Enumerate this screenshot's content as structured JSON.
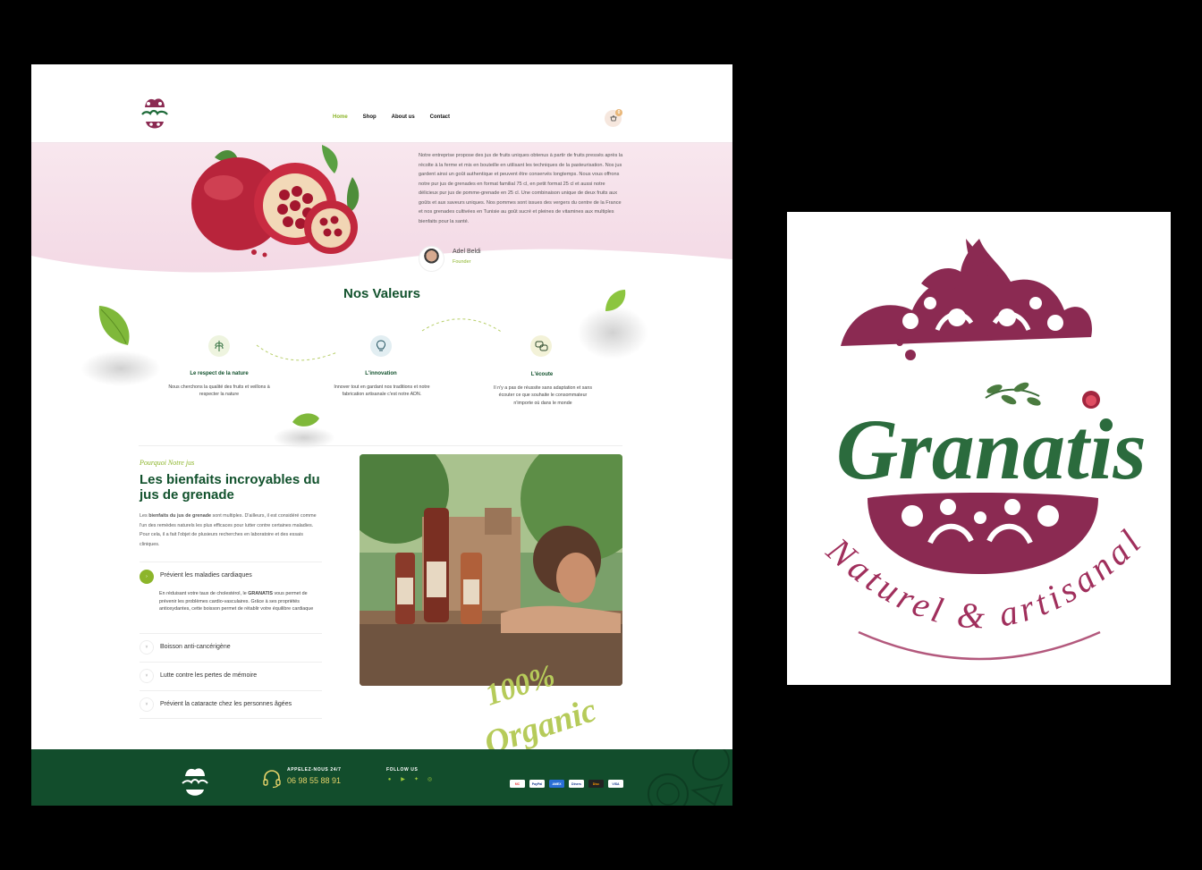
{
  "brand": {
    "name": "Granatis",
    "tagline": "Naturel & artisanal"
  },
  "colors": {
    "primary": "#12522d",
    "accent": "#8cb52a",
    "wine": "#8b2a52",
    "footer": "#124d2c",
    "hero_pink": "#f6dfe9"
  },
  "nav": {
    "items": [
      {
        "label": "Home",
        "active": true
      },
      {
        "label": "Shop",
        "active": false
      },
      {
        "label": "About us",
        "active": false
      },
      {
        "label": "Contact",
        "active": false
      }
    ],
    "cart_count": "0"
  },
  "hero": {
    "text": "Notre entreprise propose des jus de fruits uniques obtenus à partir de fruits pressés après la récolte à la ferme et mis en bouteille en utilisant les techniques de la pasteurisation. Nos jus gardent ainsi un goût authentique et peuvent être conservés longtemps. Nous vous offrons notre pur jus de grenades en format familial 75 cl, en petit format 25 cl et aussi notre délicieux pur jus de pomme-grenade en 25 cl. Une combinaison unique de deux fruits aux goûts et aux saveurs uniques. Nos pommes sont issues des vergers du centre de la France et nos grenades cultivées en Tunisie au goût sucré et pleines de vitamines aux multiples bienfaits pour la santé.",
    "founder_name": "Adel Beldi",
    "founder_role": "Founder"
  },
  "values": {
    "title": "Nos Valeurs",
    "items": [
      {
        "icon": "wheat-icon",
        "title": "Le respect de la nature",
        "desc": "Nous cherchons la qualité des fruits et veillons à respecter la nature"
      },
      {
        "icon": "lightbulb-icon",
        "title": "L'innovation",
        "desc": "Innover tout en gardant nos traditions et notre fabrication artisanale c'est notre ADN."
      },
      {
        "icon": "chat-bubbles-icon",
        "title": "L'écoute",
        "desc": "Il n'y a pas de réussite sans adaptation et sans écouter ce que souhaite le consommateur n'importe où dans le monde"
      }
    ]
  },
  "benefits": {
    "eyebrow": "Pourquoi Notre jus",
    "title": "Les bienfaits incroyables du jus de grenade",
    "para_before": "Les ",
    "para_bold": "bienfaits du jus de grenade",
    "para_after": " sont multiples. D'ailleurs, il est considéré comme l'un des remèdes naturels les plus efficaces pour lutter contre certaines maladies. Pour cela, il a fait l'objet de plusieurs recherches en laboratoire et des essais cliniques.",
    "accordion": [
      {
        "label": "Prévient les maladies cardiaques",
        "open": true
      },
      {
        "label": "Boisson anti-cancérigène",
        "open": false
      },
      {
        "label": "Lutte contre les pertes de mémoire",
        "open": false
      },
      {
        "label": "Prévient la cataracte chez les personnes âgées",
        "open": false
      }
    ],
    "open_body_before": "En réduisant votre taux de cholestérol, le ",
    "open_body_bold": "GRANATIS",
    "open_body_after": " vous permet de prévenir les problèmes cardio-vasculaires. Grâce à ses propriétés antioxydantes, cette boisson permet de rétablir votre équilibre cardiaque",
    "stamp_top": "100%",
    "stamp_bottom": "Organic"
  },
  "footer": {
    "call_label": "APPELEZ-NOUS 24/7",
    "phone": "06 98 55 88 91",
    "follow_label": "FOLLOW US",
    "socials": [
      "facebook-icon",
      "youtube-icon",
      "twitter-icon",
      "instagram-icon"
    ],
    "payments": [
      "MC",
      "PayPal",
      "AMEX",
      "Diners",
      "Disc",
      "VISA"
    ]
  }
}
